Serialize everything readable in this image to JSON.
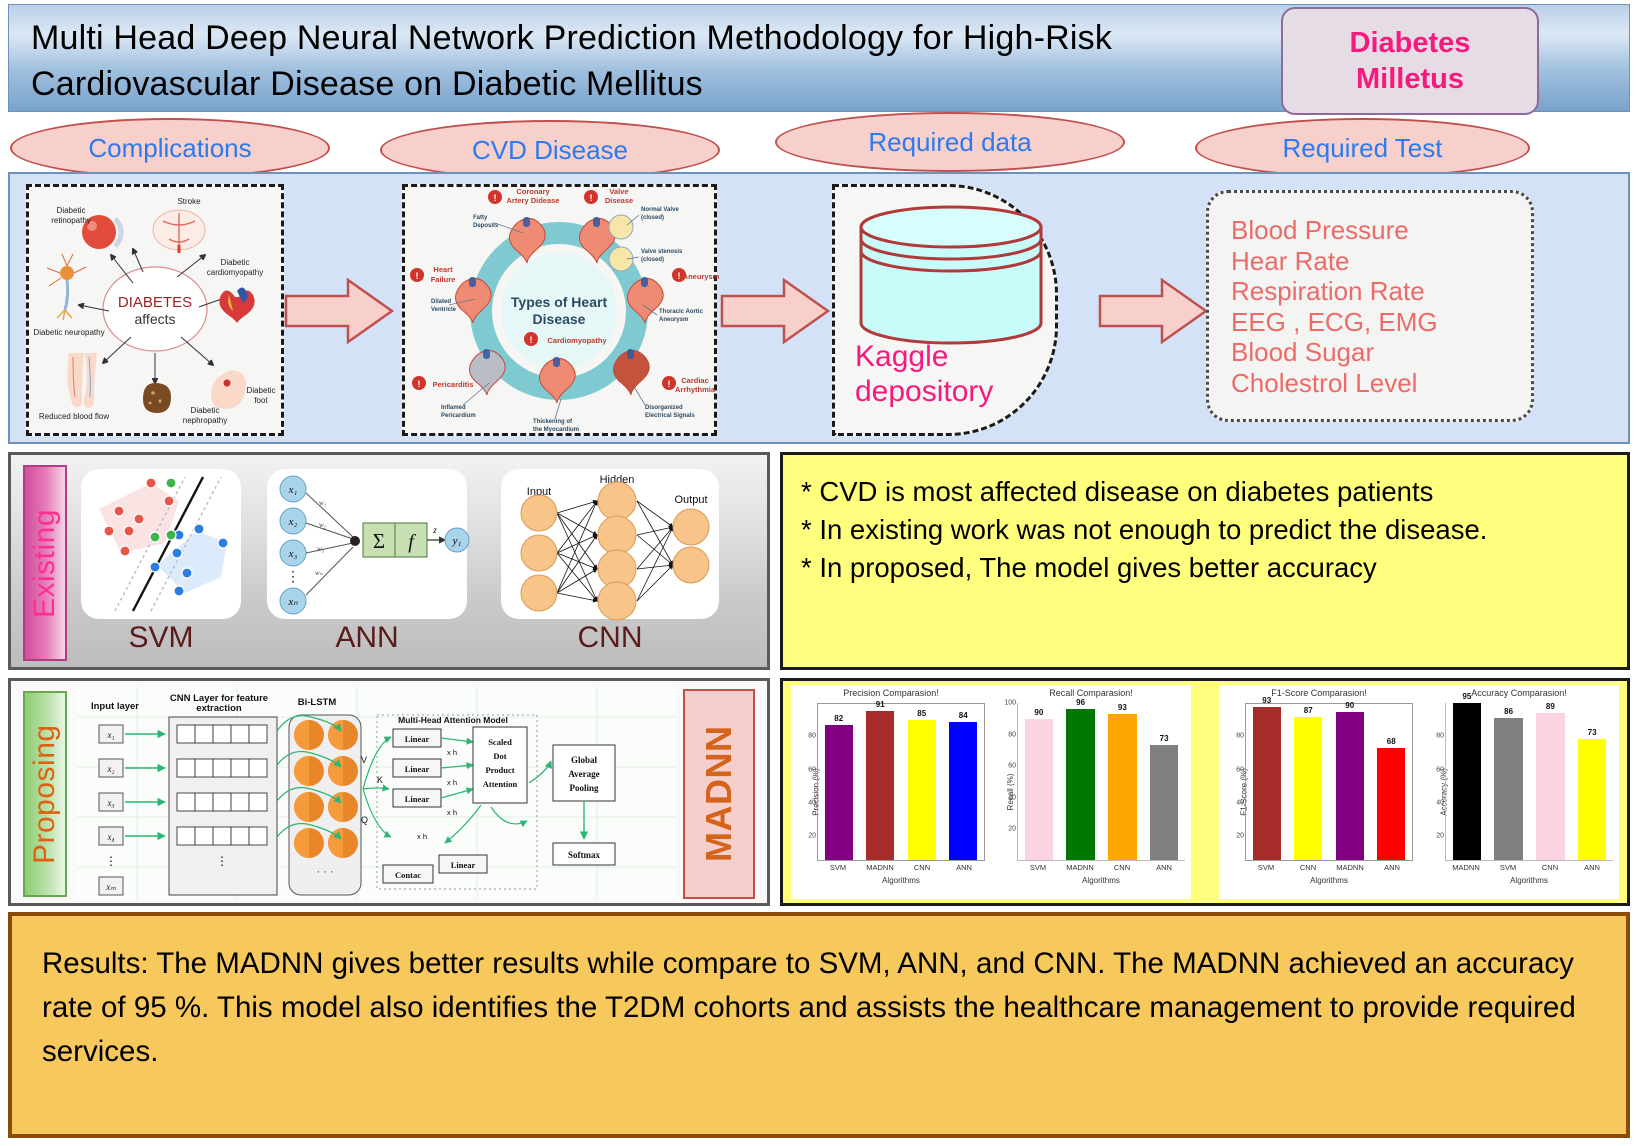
{
  "header": {
    "title": "Multi Head Deep Neural Network Prediction Methodology for High-Risk Cardiovascular Disease on Diabetic Mellitus",
    "badge_line1": "Diabetes",
    "badge_line2": "Milletus"
  },
  "stage_labels": {
    "complications": "Complications",
    "cvd_disease": "CVD Disease",
    "required_data": "Required data",
    "required_test": "Required Test"
  },
  "complications_figure": {
    "center_line1": "DIABETES",
    "center_line2": "affects",
    "items": [
      "Diabetic retinopathy",
      "Stroke",
      "Diabetic cardiomyopathy",
      "Diabetic neuropathy",
      "Reduced blood flow",
      "Diabetic nephropathy",
      "Diabetic foot"
    ]
  },
  "cvd_figure": {
    "center_line1": "Types of Heart",
    "center_line2": "Disease",
    "labels": [
      "Coronary Artery Didease",
      "Valve Disease",
      "Heart Failure",
      "Aneurysm",
      "Pericarditis",
      "Cardiomyopathy",
      "Cardiac Arrhythmia"
    ],
    "callouts": [
      "Fatty Deposits",
      "Normal Valve (closed)",
      "Valve stenosis (closed)",
      "Dilated Ventricle",
      "Thoracic Aortic Aneurysm",
      "Inflamed Pericardium",
      "Disorganized Electrical Signals",
      "Thickening of the Myocardium"
    ]
  },
  "repository": {
    "label_line1": "Kaggle",
    "label_line2": "depository"
  },
  "required_tests": [
    "Blood Pressure",
    "Hear Rate",
    "Respiration Rate",
    "EEG , ECG, EMG",
    "Blood Sugar",
    "Cholestrol Level"
  ],
  "existing": {
    "side_label": "Existing",
    "models": [
      "SVM",
      "ANN",
      "CNN"
    ],
    "ann_figure": {
      "inputs": [
        "x₁",
        "x₂",
        "x₃",
        "xₙ"
      ],
      "weights": [
        "w₁",
        "w₂",
        "w₃",
        "wₙ"
      ],
      "sum_symbol": "Σ",
      "activation_symbol": "f",
      "net_label": "z",
      "output": "y₁"
    },
    "cnn_figure": {
      "layers": [
        "Input",
        "Hidden",
        "Output"
      ]
    }
  },
  "proposing": {
    "side_label": "Proposing",
    "model_name": "MADNN",
    "figure": {
      "input_layer": "Input layer",
      "cnn_layer": "CNN Layer for feature extraction",
      "bilstm": "Bi-LSTM",
      "attention_title": "Multi-Head Attention Model",
      "inputs": [
        "x₁",
        "x₂",
        "x₃",
        "x₄",
        "xₘ"
      ],
      "qkv": [
        "V",
        "K",
        "Q"
      ],
      "linear": "Linear",
      "xh": "x h",
      "scaled_attention": "Scaled Dot Product Attention",
      "concat": "Contac",
      "gap": "Global Average Pooling",
      "softmax": "Softmax"
    }
  },
  "notes": [
    "* CVD is most affected disease on diabetes patients",
    "* In existing work was not enough to predict the disease.",
    "* In proposed, The model gives better accuracy"
  ],
  "results": {
    "text": "Results: The MADNN gives better results while compare to SVM, ANN, and  CNN. The MADNN achieved an accuracy rate of 95 %. This model also identifies the T2DM cohorts and assists the healthcare management to provide required services."
  },
  "chart_data": [
    {
      "type": "bar",
      "title": "Precision Comparasion!",
      "categories": [
        "SVM",
        "MADNN",
        "CNN",
        "ANN"
      ],
      "values": [
        82,
        91,
        85,
        84
      ],
      "colors": [
        "#800080",
        "#a62c2c",
        "#ffff00",
        "#0000ff"
      ],
      "xlabel": "Algorithms",
      "ylabel": "Precision (%)",
      "yticks": [
        20,
        40,
        60,
        80
      ],
      "ylim": [
        0,
        100
      ],
      "grid": false
    },
    {
      "type": "bar",
      "title": "Recall Comparasion!",
      "categories": [
        "SVM",
        "MADNN",
        "CNN",
        "ANN"
      ],
      "values": [
        90,
        96,
        93,
        73
      ],
      "colors": [
        "#fcd3e1",
        "#007800",
        "#ffa500",
        "#808080"
      ],
      "xlabel": "Algorithms",
      "ylabel": "Recall (%)",
      "yticks": [
        20,
        40,
        60,
        80,
        100
      ],
      "ylim": [
        0,
        100
      ],
      "grid": false
    },
    {
      "type": "bar",
      "title": "F1-Score Comparasion!",
      "categories": [
        "SVM",
        "CNN",
        "MADNN",
        "ANN"
      ],
      "values": [
        93,
        87,
        90,
        68
      ],
      "colors": [
        "#a62c2c",
        "#ffff00",
        "#800080",
        "#ff0000"
      ],
      "xlabel": "Algorithms",
      "ylabel": "F1-Score (%)",
      "yticks": [
        20,
        40,
        60,
        80
      ],
      "ylim": [
        0,
        100
      ],
      "grid": false
    },
    {
      "type": "bar",
      "title": "Accuracy Comparasion!",
      "categories": [
        "MADNN",
        "SVM",
        "CNN",
        "ANN"
      ],
      "values": [
        95,
        86,
        89,
        73
      ],
      "colors": [
        "#000000",
        "#808080",
        "#fcd3e1",
        "#ffff00"
      ],
      "xlabel": "Algorithms",
      "ylabel": "Accuracy (%)",
      "yticks": [
        20,
        40,
        60,
        80
      ],
      "ylim": [
        0,
        100
      ],
      "grid": false
    }
  ]
}
